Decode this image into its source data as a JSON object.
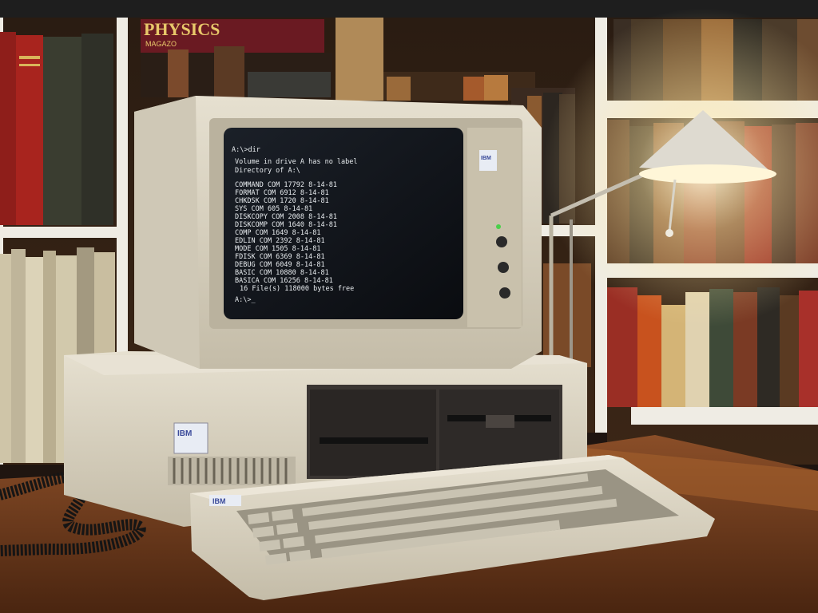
{
  "scene": {
    "book_spine_text": "PHYSICS",
    "book_spine_subtext": "MAGAZO",
    "monitor_badge": "IBM",
    "system_unit_badge": "IBM",
    "keyboard_badge": "IBM"
  },
  "screen": {
    "lines": [
      "A:\\>dir",
      "Volume in drive A has no label",
      "Directory of A:\\",
      "COMMAND  COM   17792  8-14-81",
      "FORMAT   COM    6912  8-14-81",
      "CHKDSK   COM    1720  8-14-81",
      "SYS      COM     605  8-14-81",
      "DISKCOPY COM    2008  8-14-81",
      "DISKCOMP COM    1640  8-14-81",
      "COMP     COM    1649  8-14-81",
      "EDLIN    COM    2392  8-14-81",
      "MODE     COM    1505  8-14-81",
      "FDISK    COM    6369  8-14-81",
      "DEBUG    COM    6049  8-14-81",
      "BASIC    COM   10880  8-14-81",
      "BASICA   COM   16256  8-14-81",
      "16 File(s)    118000 bytes free",
      "A:\\>_"
    ]
  },
  "colors": {
    "wood": "#6b3a1f",
    "case_beige": "#d9d2c0",
    "lamp_glow": "#fff4d0",
    "crt_bg": "#0d1014"
  }
}
